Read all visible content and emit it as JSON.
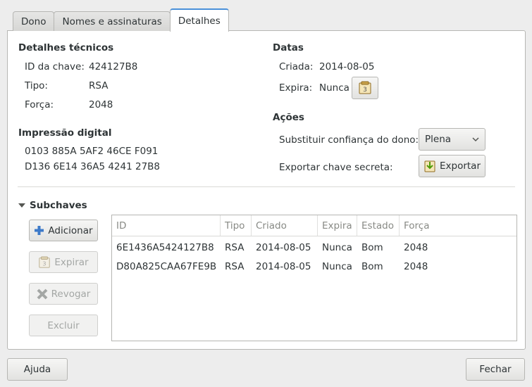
{
  "tabs": [
    "Dono",
    "Nomes e assinaturas",
    "Detalhes"
  ],
  "technical": {
    "heading": "Detalhes técnicos",
    "id_label": "ID da chave:",
    "id_value": "424127B8",
    "type_label": "Tipo:",
    "type_value": "RSA",
    "strength_label": "Força:",
    "strength_value": "2048"
  },
  "fingerprint": {
    "heading": "Impressão digital",
    "line1": "0103 885A 5AF2 46CE F091",
    "line2": "D136 6E14 36A5 4241 27B8"
  },
  "dates": {
    "heading": "Datas",
    "created_label": "Criada:",
    "created_value": "2014-08-05",
    "expires_label": "Expira:",
    "expires_value": "Nunca"
  },
  "actions": {
    "heading": "Ações",
    "trust_label": "Substituir confiança do dono:",
    "trust_value": "Plena",
    "export_label": "Exportar chave secreta:",
    "export_button": "Exportar"
  },
  "subkeys": {
    "heading": "Subchaves",
    "add": "Adicionar",
    "expire": "Expirar",
    "revoke": "Revogar",
    "delete": "Excluir",
    "columns": [
      "ID",
      "Tipo",
      "Criado",
      "Expira",
      "Estado",
      "Força"
    ],
    "rows": [
      [
        "6E1436A5424127B8",
        "RSA",
        "2014-08-05",
        "Nunca",
        "Bom",
        "2048"
      ],
      [
        "D80A825CAA67FE9B",
        "RSA",
        "2014-08-05",
        "Nunca",
        "Bom",
        "2048"
      ]
    ]
  },
  "footer": {
    "help": "Ajuda",
    "close": "Fechar"
  },
  "colors": {
    "accent": "#4a90d9",
    "add_icon": "#3d7ac9",
    "revoke_icon": "#a4a7a5"
  }
}
